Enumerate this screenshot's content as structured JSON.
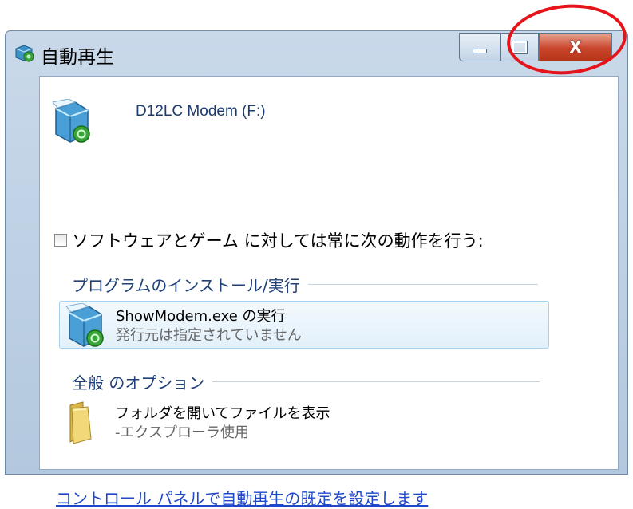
{
  "window": {
    "title": "自動再生",
    "title_icon": "autoplay-icon",
    "controls": {
      "minimize": "minimize-icon",
      "maximize": "maximize-icon",
      "close_label": "X"
    }
  },
  "device": {
    "name": "D12LC Modem (F:)",
    "icon": "software-box-icon"
  },
  "always_do": {
    "label": "ソフトウェアとゲーム に対しては常に次の動作を行う:",
    "checked": false
  },
  "sections": {
    "install": {
      "heading": "プログラムのインストール/実行",
      "option": {
        "line1": "ShowModem.exe の実行",
        "line2": "発行元は指定されていません",
        "icon": "software-box-icon"
      }
    },
    "general": {
      "heading": "全般 のオプション",
      "option": {
        "line1": "フォルダを開いてファイルを表示",
        "line2": "-エクスプローラ使用",
        "icon": "folder-icon"
      }
    }
  },
  "footer_link": "コントロール パネルで自動再生の既定を設定します",
  "annotation": {
    "shape": "red-circle",
    "color": "#e5141a",
    "target": "close-button"
  }
}
